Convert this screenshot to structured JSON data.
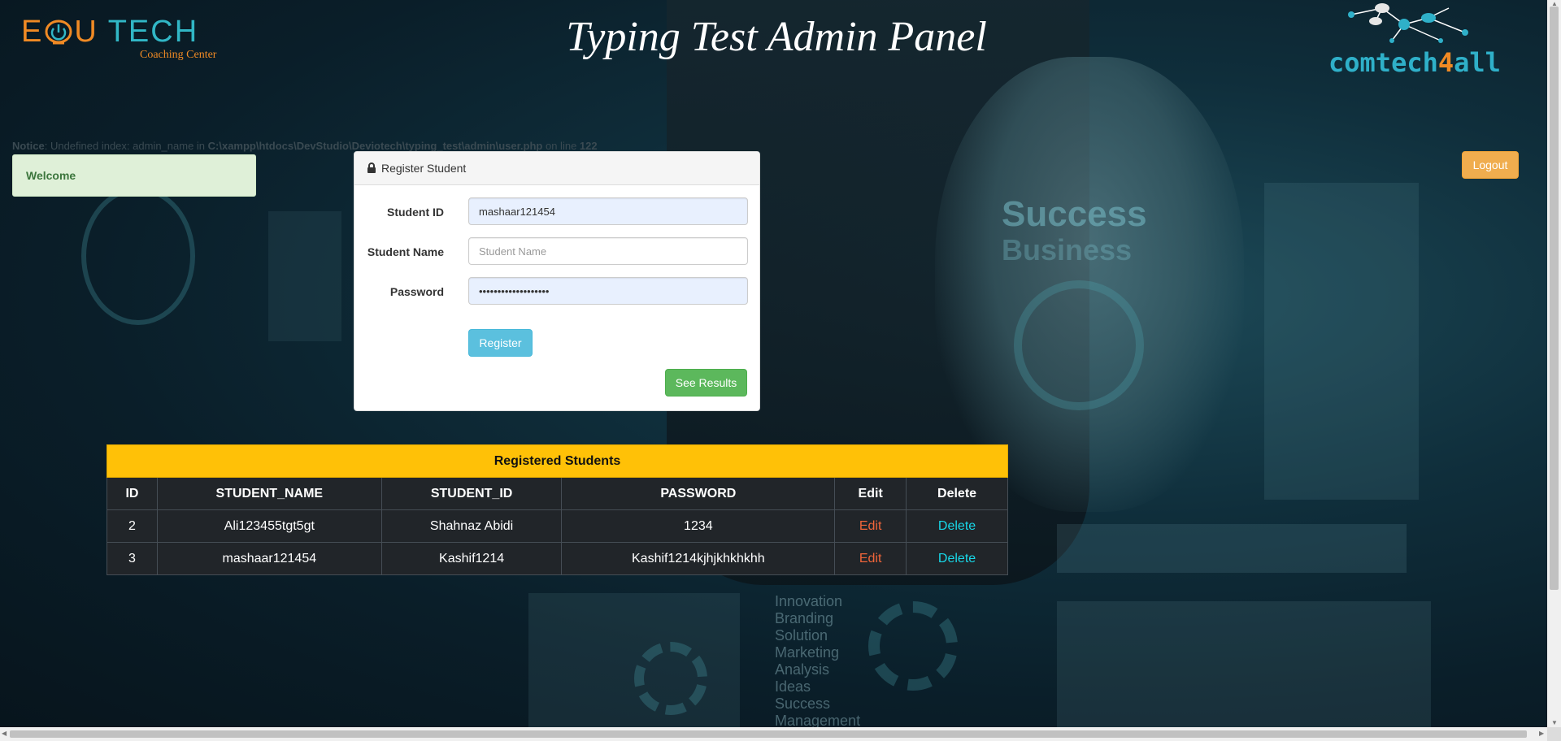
{
  "header": {
    "title": "Typing Test Admin Panel",
    "left_logo": {
      "edu": "E",
      "o_icon": "power-icon",
      "u": "U",
      "tech": "TECH",
      "sub": "Coaching Center"
    },
    "right_logo": {
      "name_part1": "comtech",
      "name_part2": "4",
      "name_part3": "all"
    }
  },
  "notice": {
    "label": "Notice",
    "text": ": Undefined index: admin_name in ",
    "path": "C:\\xampp\\htdocs\\DevStudio\\Deviotech\\typing_test\\admin\\user.php",
    "line_text": " on line ",
    "line_no": "122"
  },
  "welcome": {
    "text": "Welcome"
  },
  "logout": {
    "label": "Logout"
  },
  "register_panel": {
    "heading": "Register Student",
    "icon": "lock-icon",
    "fields": {
      "student_id": {
        "label": "Student ID",
        "value": "mashaar121454",
        "placeholder": "Student ID"
      },
      "student_name": {
        "label": "Student Name",
        "value": "",
        "placeholder": "Student Name"
      },
      "password": {
        "label": "Password",
        "value": "mashaar121454pass12",
        "placeholder": "Password"
      }
    },
    "register_label": "Register",
    "results_label": "See Results"
  },
  "table": {
    "caption": "Registered Students",
    "columns": [
      "ID",
      "STUDENT_NAME",
      "STUDENT_ID",
      "PASSWORD",
      "Edit",
      "Delete"
    ],
    "rows": [
      {
        "id": "2",
        "student_name": "Ali123455tgt5gt",
        "student_id": "Shahnaz Abidi",
        "password": "1234",
        "edit": "Edit",
        "delete": "Delete"
      },
      {
        "id": "3",
        "student_name": "mashaar121454",
        "student_id": "Kashif1214",
        "password": "Kashif1214kjhjkhkhkhh",
        "edit": "Edit",
        "delete": "Delete"
      }
    ]
  },
  "background": {
    "success_text": "Success",
    "business_text": "Business",
    "words": [
      "Innovation",
      "Branding",
      "Solution",
      "Marketing",
      "Analysis",
      "Ideas",
      "Success",
      "Management"
    ]
  },
  "colors": {
    "table_caption": "#ffc107",
    "table_dark": "#212529",
    "edit_link": "#f0653a",
    "delete_link": "#17d8e8",
    "logout": "#f0ad4e",
    "register": "#5bc0de",
    "results": "#5cb85c",
    "welcome_bg": "#dff0d8"
  }
}
